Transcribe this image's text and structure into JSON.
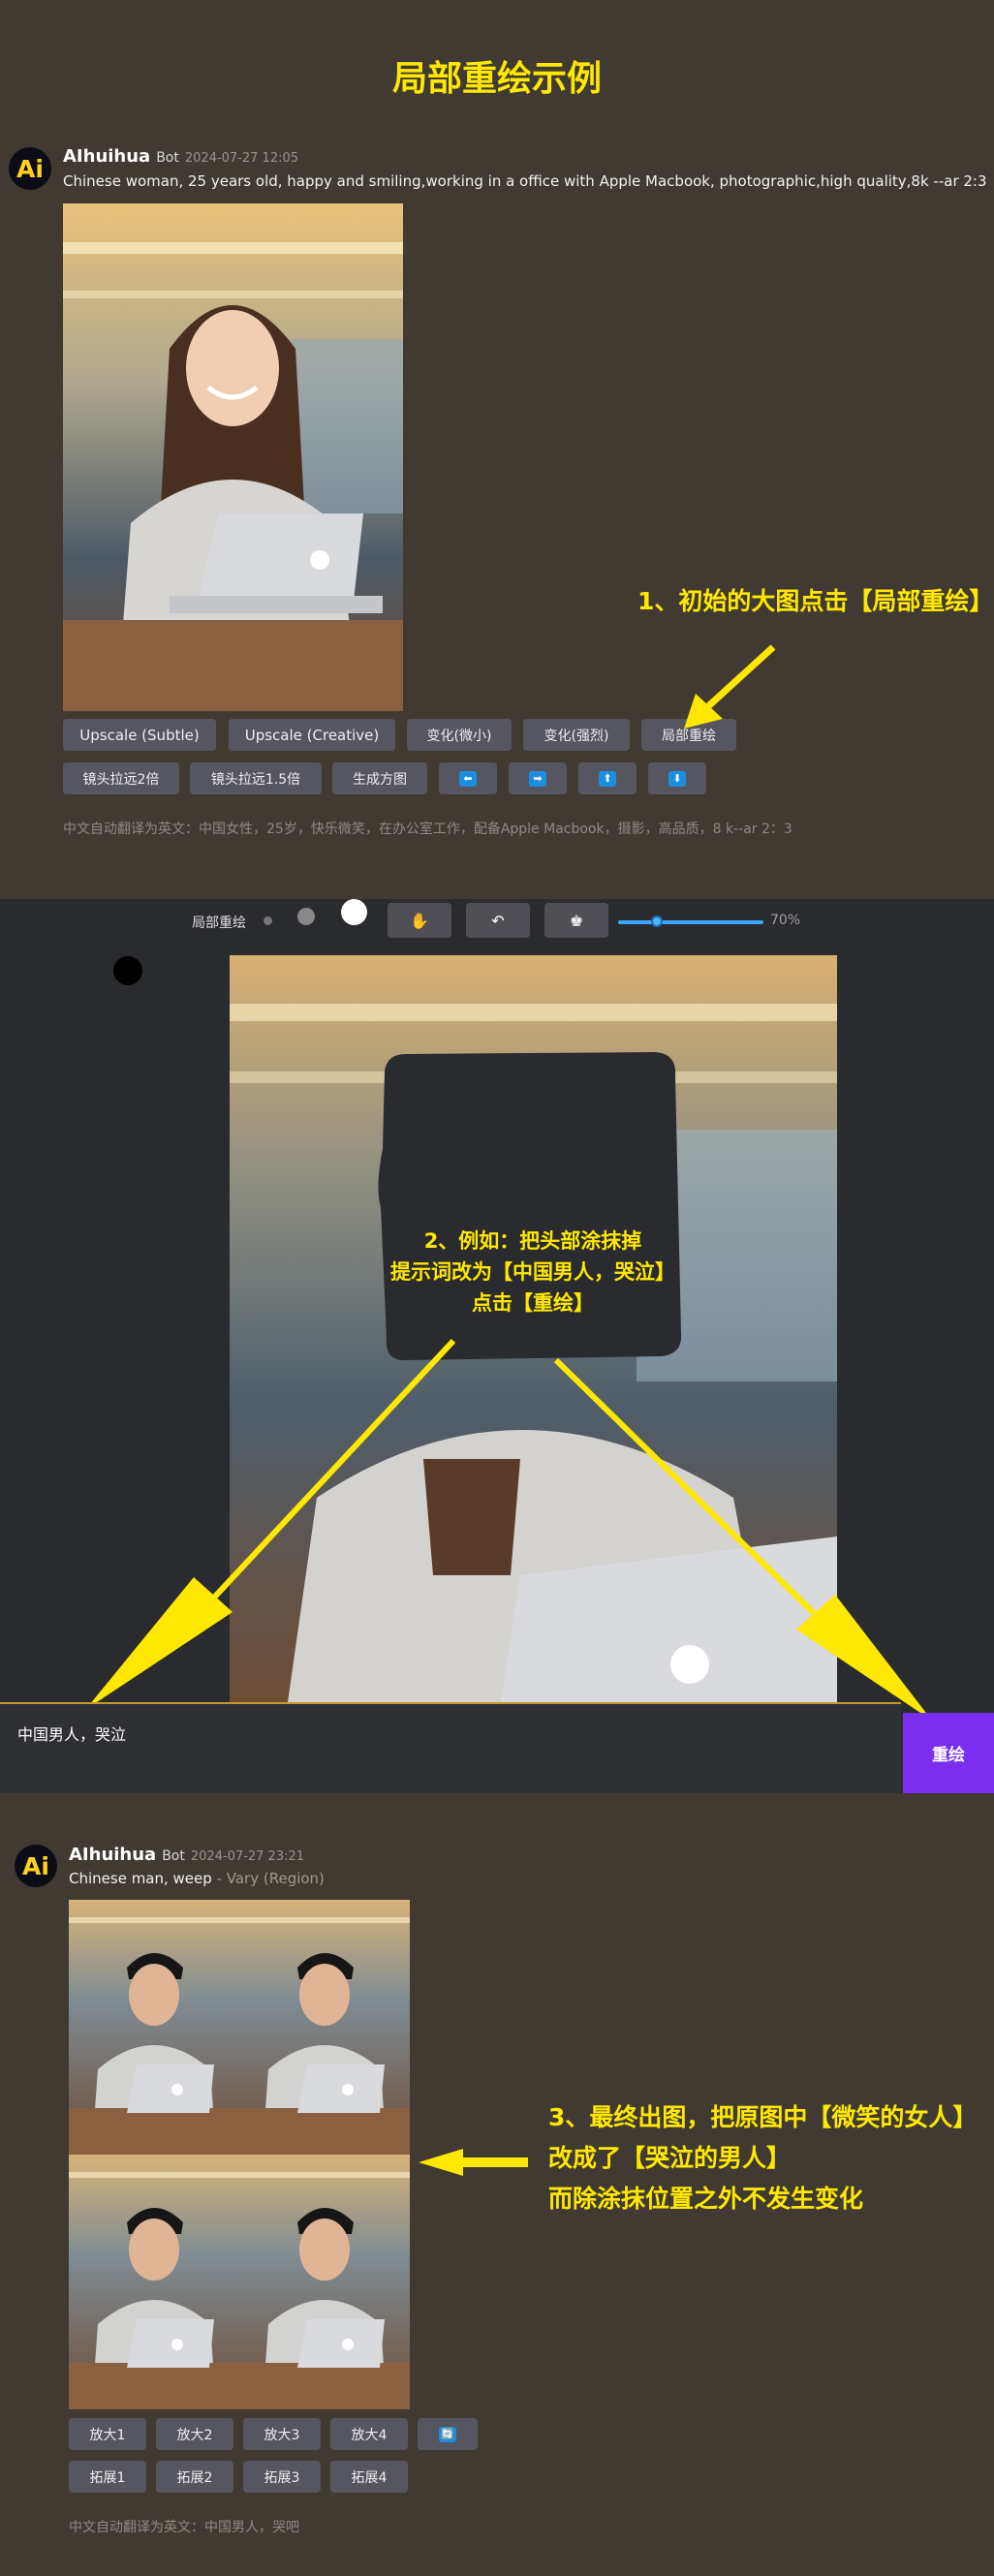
{
  "page_title": "局部重绘示例",
  "message1": {
    "avatar": "Ai",
    "author": "AIhuihua",
    "bot_label": "Bot",
    "time": "2024-07-27 12:05",
    "prompt": "Chinese woman, 25 years old, happy and smiling,working in a office with Apple Macbook, photographic,high quality,8k --ar 2:3",
    "buttons_row1": [
      "Upscale (Subtle)",
      "Upscale (Creative)",
      "变化(微小)",
      "变化(强烈)",
      "局部重绘"
    ],
    "buttons_row2": [
      "镜头拉远2倍",
      "镜头拉远1.5倍",
      "生成方图",
      "⬅",
      "➡",
      "⬆",
      "⬇"
    ],
    "translation": "中文自动翻译为英文：中国女性，25岁，快乐微笑，在办公室工作，配备Apple Macbook，摄影，高品质，8 k--ar 2：3"
  },
  "annotation1": "1、初始的大图点击【局部重绘】",
  "editor": {
    "label": "局部重绘",
    "tools": [
      "hand-icon",
      "undo-icon",
      "erase-icon"
    ],
    "zoom": "70%",
    "zoom_level": 0.2,
    "input_value": "中国男人，哭泣",
    "submit_label": "重绘",
    "annotation_lines": [
      "2、例如：把头部涂抹掉",
      "提示词改为【中国男人，哭泣】",
      "点击【重绘】"
    ]
  },
  "message2": {
    "avatar": "Ai",
    "author": "AIhuihua",
    "bot_label": "Bot",
    "time": "2024-07-27 23:21",
    "prompt": "Chinese man, weep",
    "prompt_suffix": "- Vary (Region)",
    "buttons_row1": [
      "放大1",
      "放大2",
      "放大3",
      "放大4",
      "🔄"
    ],
    "buttons_row2": [
      "拓展1",
      "拓展2",
      "拓展3",
      "拓展4"
    ],
    "translation": "中文自动翻译为英文：中国男人，哭吧"
  },
  "annotation3_lines": [
    "3、最终出图，把原图中【微笑的女人】",
    "改成了【哭泣的男人】",
    "而除涂抹位置之外不发生变化"
  ],
  "colors": {
    "annotation": "#ffe800",
    "background": "#403a33",
    "editor_bg": "#2a2b2f",
    "submit": "#7a2ef0",
    "button": "#55565f"
  }
}
